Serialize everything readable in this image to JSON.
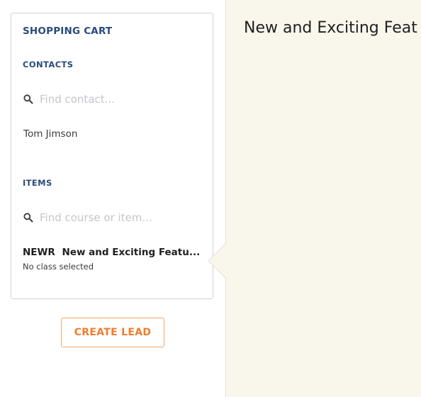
{
  "cart": {
    "title": "SHOPPING CART",
    "contacts": {
      "label": "CONTACTS",
      "search_placeholder": "Find contact...",
      "selected_contact": "Tom Jimson"
    },
    "items": {
      "label": "ITEMS",
      "search_placeholder": "Find course or item...",
      "list": [
        {
          "code": "NEWR",
          "name": "New and Exciting Featu...",
          "subtitle": "No class selected"
        }
      ]
    },
    "create_lead_label": "CREATE LEAD"
  },
  "detail": {
    "title": "New and Exciting Feat"
  },
  "colors": {
    "heading_blue": "#2b4a7c",
    "accent_orange": "#ef7c2c",
    "detail_background": "#f9f7ec"
  }
}
